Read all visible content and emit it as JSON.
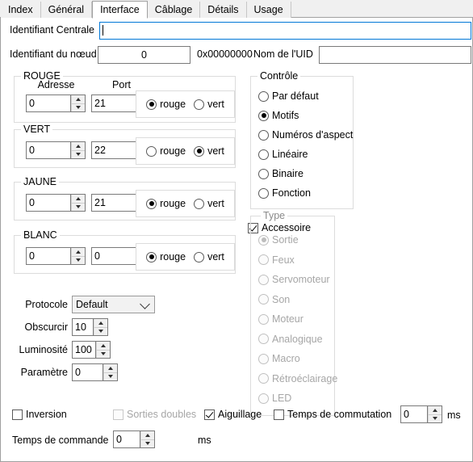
{
  "window": {
    "tabs": [
      {
        "label": "Index",
        "active": false
      },
      {
        "label": "Général",
        "active": false
      },
      {
        "label": "Interface",
        "active": true
      },
      {
        "label": "Câblage",
        "active": false
      },
      {
        "label": "Détails",
        "active": false
      },
      {
        "label": "Usage",
        "active": false
      }
    ]
  },
  "identity": {
    "central_label": "Identifiant Centrale",
    "central_value": "",
    "node_label": "Identifiant du nœud",
    "node_value": "0",
    "node_hex": "0x00000000",
    "uid_label": "Nom de l'UID",
    "uid_value": ""
  },
  "color_groups": [
    {
      "title": "ROUGE",
      "address_label": "Adresse",
      "address_value": "0",
      "port_label": "Port",
      "port_value": "21",
      "radio_rouge": "rouge",
      "radio_vert": "vert",
      "selected": "rouge"
    },
    {
      "title": "VERT",
      "address_label": "",
      "address_value": "0",
      "port_label": "",
      "port_value": "22",
      "radio_rouge": "rouge",
      "radio_vert": "vert",
      "selected": "vert"
    },
    {
      "title": "JAUNE",
      "address_label": "",
      "address_value": "0",
      "port_label": "",
      "port_value": "21",
      "radio_rouge": "rouge",
      "radio_vert": "vert",
      "selected": "rouge"
    },
    {
      "title": "BLANC",
      "address_label": "",
      "address_value": "0",
      "port_label": "",
      "port_value": "0",
      "radio_rouge": "rouge",
      "radio_vert": "vert",
      "selected": "rouge"
    }
  ],
  "settings": {
    "protocole_label": "Protocole",
    "protocole_value": "Default",
    "obscurcir_label": "Obscurcir",
    "obscurcir_value": "10",
    "luminosite_label": "Luminosité",
    "luminosite_value": "100",
    "parametre_label": "Paramètre",
    "parametre_value": "0"
  },
  "controle": {
    "title": "Contrôle",
    "options": [
      {
        "label": "Par défaut",
        "selected": false
      },
      {
        "label": "Motifs",
        "selected": true
      },
      {
        "label": "Numéros d'aspect",
        "selected": false
      },
      {
        "label": "Linéaire",
        "selected": false
      },
      {
        "label": "Binaire",
        "selected": false
      },
      {
        "label": "Fonction",
        "selected": false
      }
    ]
  },
  "accessoire": {
    "label": "Accessoire",
    "checked": true
  },
  "type": {
    "title": "Type",
    "disabled": true,
    "options": [
      {
        "label": "Sortie",
        "selected": true
      },
      {
        "label": "Feux",
        "selected": false
      },
      {
        "label": "Servomoteur",
        "selected": false
      },
      {
        "label": "Son",
        "selected": false
      },
      {
        "label": "Moteur",
        "selected": false
      },
      {
        "label": "Analogique",
        "selected": false
      },
      {
        "label": "Macro",
        "selected": false
      },
      {
        "label": "Rétroéclairage",
        "selected": false
      },
      {
        "label": "LED",
        "selected": false
      }
    ]
  },
  "bottom": {
    "inversion_label": "Inversion",
    "inversion_checked": false,
    "sorties_doubles_label": "Sorties doubles",
    "sorties_doubles_checked": false,
    "sorties_doubles_disabled": true,
    "aiguillage_label": "Aiguillage",
    "aiguillage_checked": true,
    "commutation_label": "Temps de commutation",
    "commutation_checked": false,
    "commutation_value": "0",
    "commutation_unit": "ms",
    "commande_label": "Temps de commande",
    "commande_value": "0",
    "commande_unit": "ms"
  },
  "colors": {
    "accent": "#0078d7",
    "panel_border": "#a0a0a0",
    "group_border": "#dcdcdc",
    "tab_bg": "#f0f0f0",
    "disabled_text": "#a6a6a6"
  }
}
